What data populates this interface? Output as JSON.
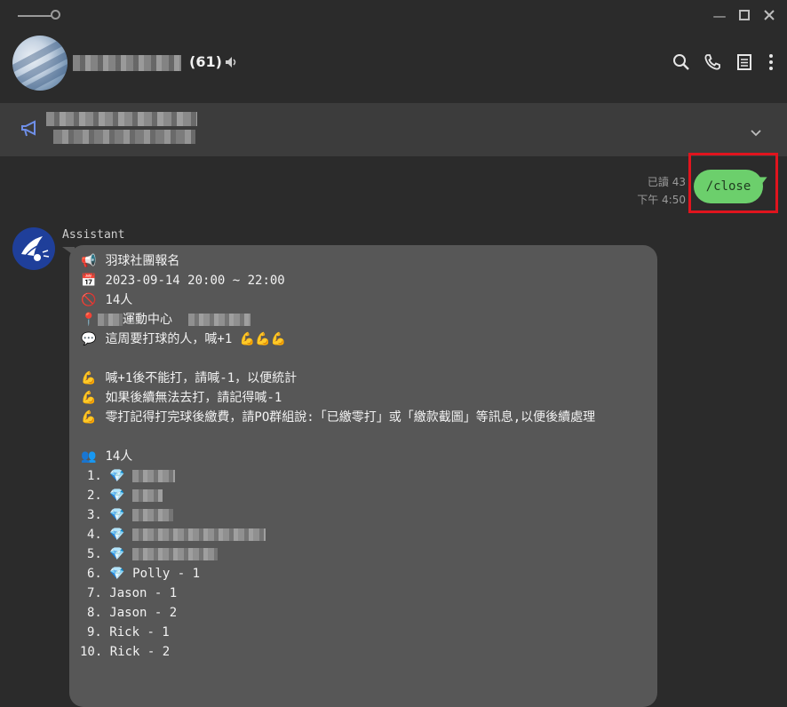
{
  "header": {
    "member_count": "(61)"
  },
  "sent": {
    "read_receipt": "已讀 43",
    "time": "下午 4:50",
    "text": "/close"
  },
  "message": {
    "sender": "Assistant",
    "lines": {
      "title": "羽球社團報名",
      "datetime": "2023-09-14 20:00 ~ 22:00",
      "capacity": "14人",
      "venue": "運動中心",
      "call": "這周要打球的人，喊+1",
      "rule1": "喊+1後不能打，請喊-1，以便統計",
      "rule2": "如果後續無法去打，請記得喊-1",
      "rule3": "零打記得打完球後繳費，請PO群組說:「已繳零打」或「繳款截圖」等訊息,以便後續處理",
      "count": "14人"
    },
    "list": [
      "1.",
      "2.",
      "3.",
      "4.",
      "5.",
      "6.",
      "7.",
      "8.",
      "9.",
      "10."
    ],
    "named": {
      "p6": "Polly - 1",
      "p7": "Jason - 1",
      "p8": "Jason - 2",
      "p9": "Rick - 1",
      "p10": "Rick - 2"
    }
  }
}
